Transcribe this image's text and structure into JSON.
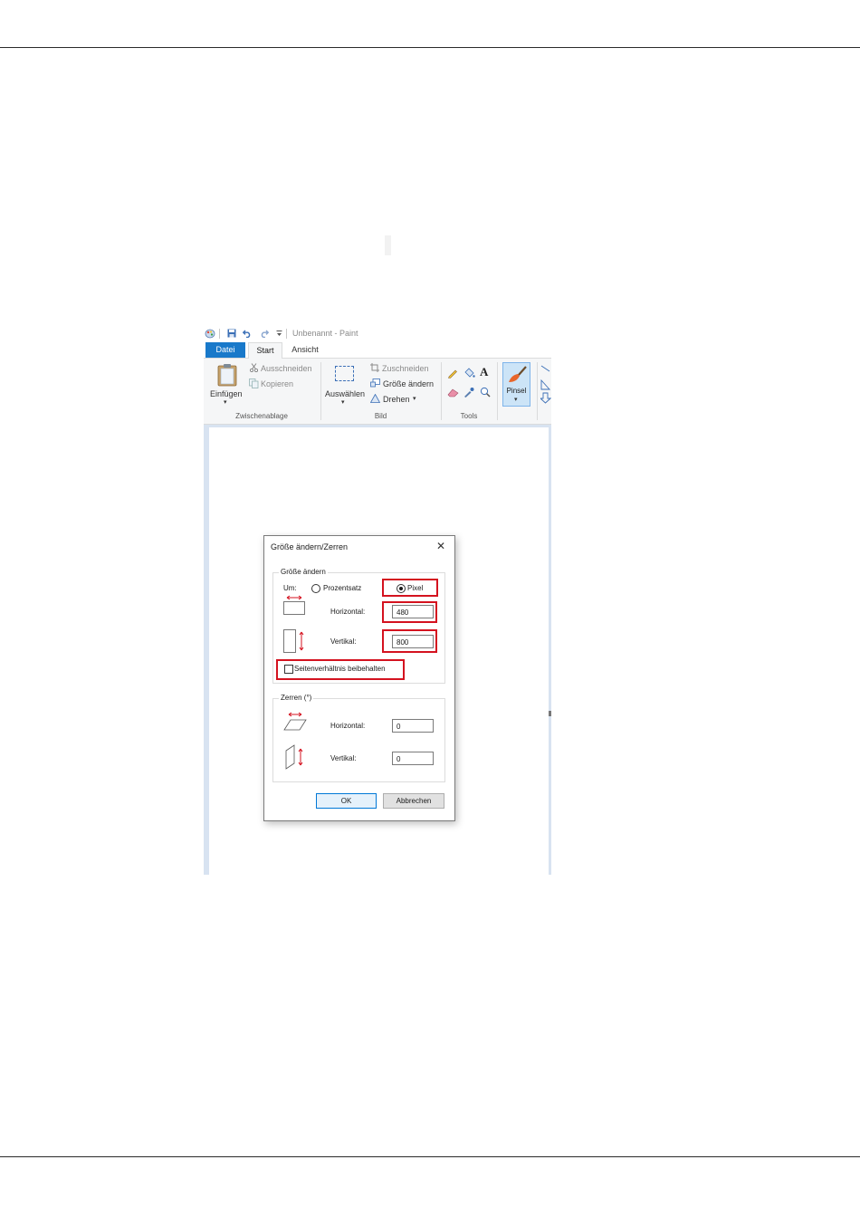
{
  "window": {
    "title": "Unbenannt - Paint"
  },
  "quick_access": {
    "icons": [
      "paint-app-icon",
      "save-icon",
      "undo-icon",
      "redo-icon",
      "customize-arrow-icon"
    ]
  },
  "tabs": [
    {
      "label": "Datei"
    },
    {
      "label": "Start"
    },
    {
      "label": "Ansicht"
    }
  ],
  "ribbon": {
    "clipboard": {
      "paste_label": "Einfügen",
      "cut_label": "Ausschneiden",
      "copy_label": "Kopieren",
      "group_label": "Zwischenablage"
    },
    "image": {
      "select_label": "Auswählen",
      "crop_label": "Zuschneiden",
      "resize_label": "Größe ändern",
      "rotate_label": "Drehen",
      "group_label": "Bild"
    },
    "tools": {
      "group_label": "Tools"
    },
    "brush": {
      "label": "Pinsel"
    }
  },
  "dialog": {
    "title": "Größe ändern/Zerren",
    "resize": {
      "legend": "Größe ändern",
      "by_label": "Um:",
      "percent_label": "Prozentsatz",
      "pixel_label": "Pixel",
      "selected_mode": "Pixel",
      "horizontal_label": "Horizontal:",
      "horizontal_value": "480",
      "vertical_label": "Vertikal:",
      "vertical_value": "800",
      "keep_ratio_label": "Seitenverhältnis beibehalten",
      "keep_ratio_checked": false
    },
    "skew": {
      "legend": "Zerren (°)",
      "horizontal_label": "Horizontal:",
      "horizontal_value": "0",
      "vertical_label": "Vertikal:",
      "vertical_value": "0"
    },
    "ok_label": "OK",
    "cancel_label": "Abbrechen"
  },
  "colors": {
    "file_tab": "#1979ca",
    "highlight": "#d4121f",
    "arrow": "#d4121f",
    "ok_border": "#0078d7"
  }
}
